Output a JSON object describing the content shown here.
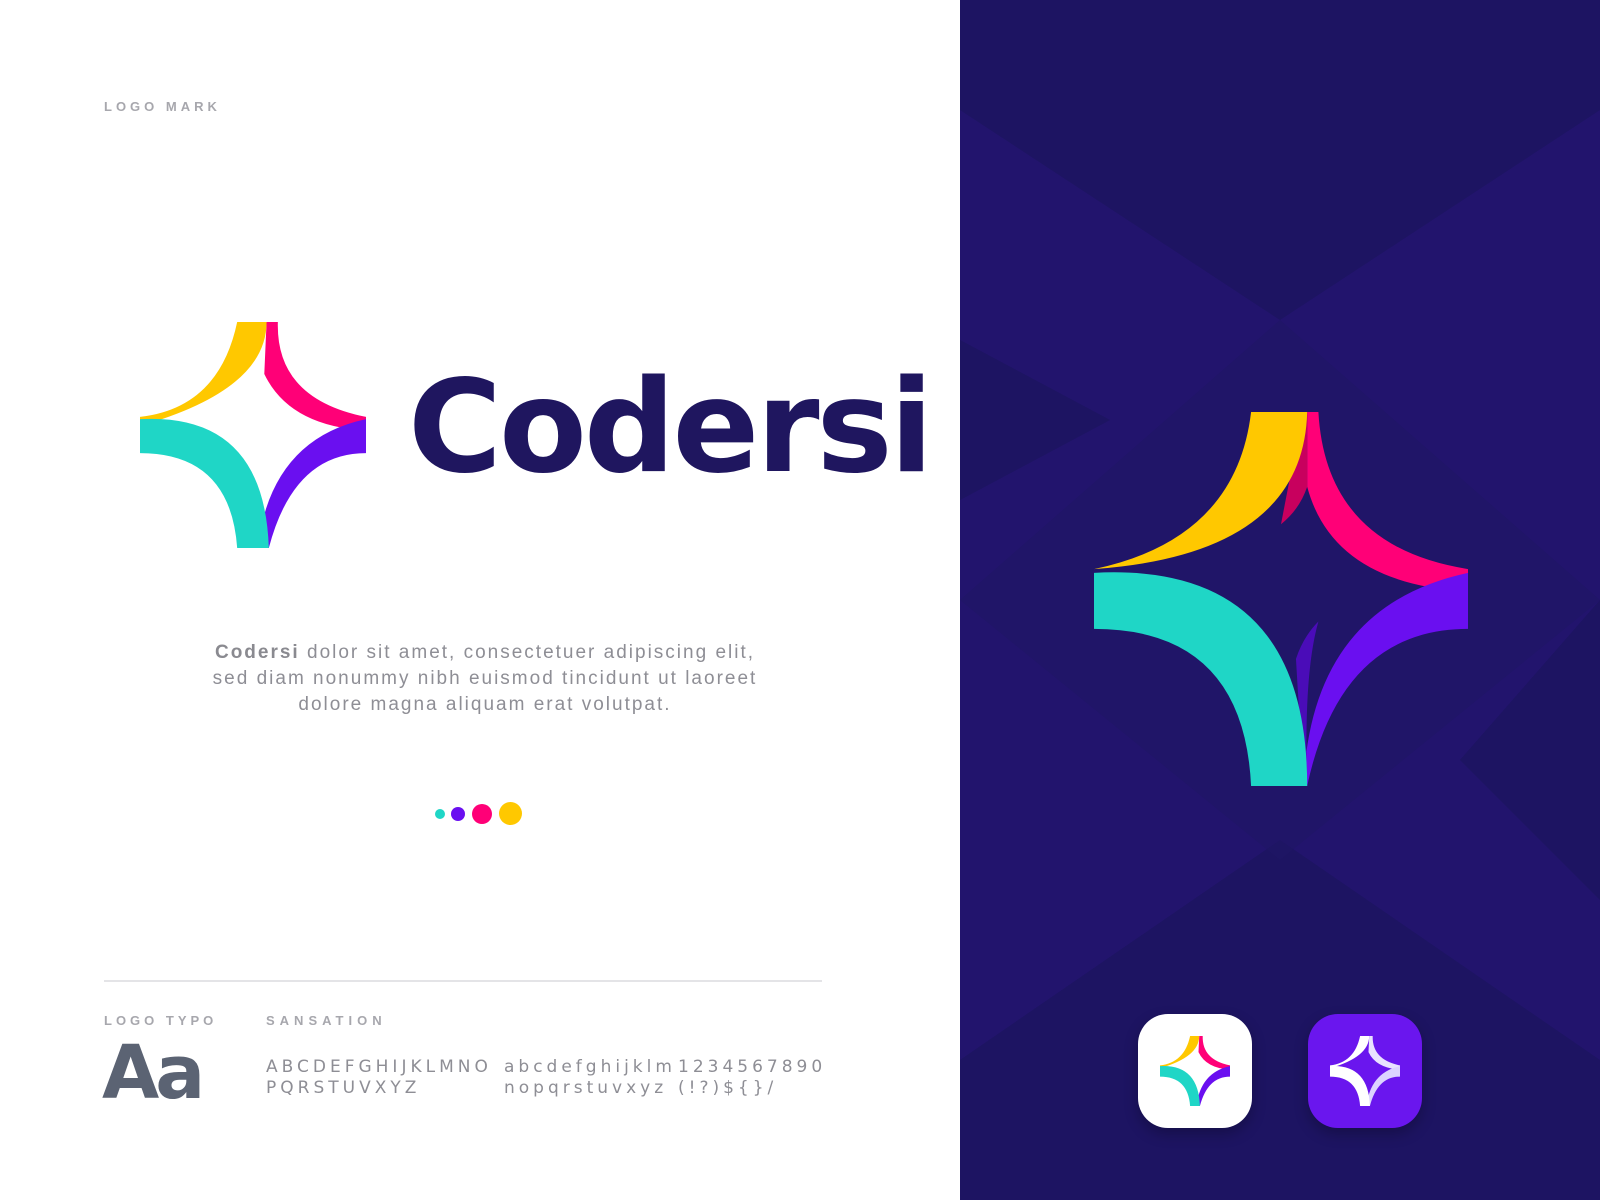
{
  "left": {
    "logo_mark_label": "LOGO MARK",
    "wordmark": "Codersi",
    "description": {
      "brand": "Codersi",
      "line1_rest": " dolor sit amet, consectetuer adipiscing elit,",
      "line2": "sed diam nonummy nibh euismod tincidunt ut laoreet",
      "line3": "dolore magna aliquam erat volutpat."
    },
    "palette": [
      "#1fd6c6",
      "#6a0ff0",
      "#ff0077",
      "#ffc800"
    ],
    "typography": {
      "label": "LOGO TYPO",
      "font_name": "SANSATION",
      "sample": "Aa",
      "upper_line1": "ABCDEFGHIJKLMNO",
      "upper_line2": "PQRSTUVXYZ",
      "lower_line1": "abcdefghijklm",
      "lower_line2": "nopqrstuvxyz",
      "digits_line1": "1234567890",
      "digits_line2": "(!?)${}/"
    }
  },
  "right": {
    "background": "#1d1462",
    "icons": [
      "colored-star-mark-icon",
      "white-star-mark-icon"
    ]
  },
  "colors": {
    "yellow": "#ffc800",
    "pink": "#ff0077",
    "purple": "#6a0ff0",
    "teal": "#1fd6c6",
    "navy": "#1f165f"
  }
}
